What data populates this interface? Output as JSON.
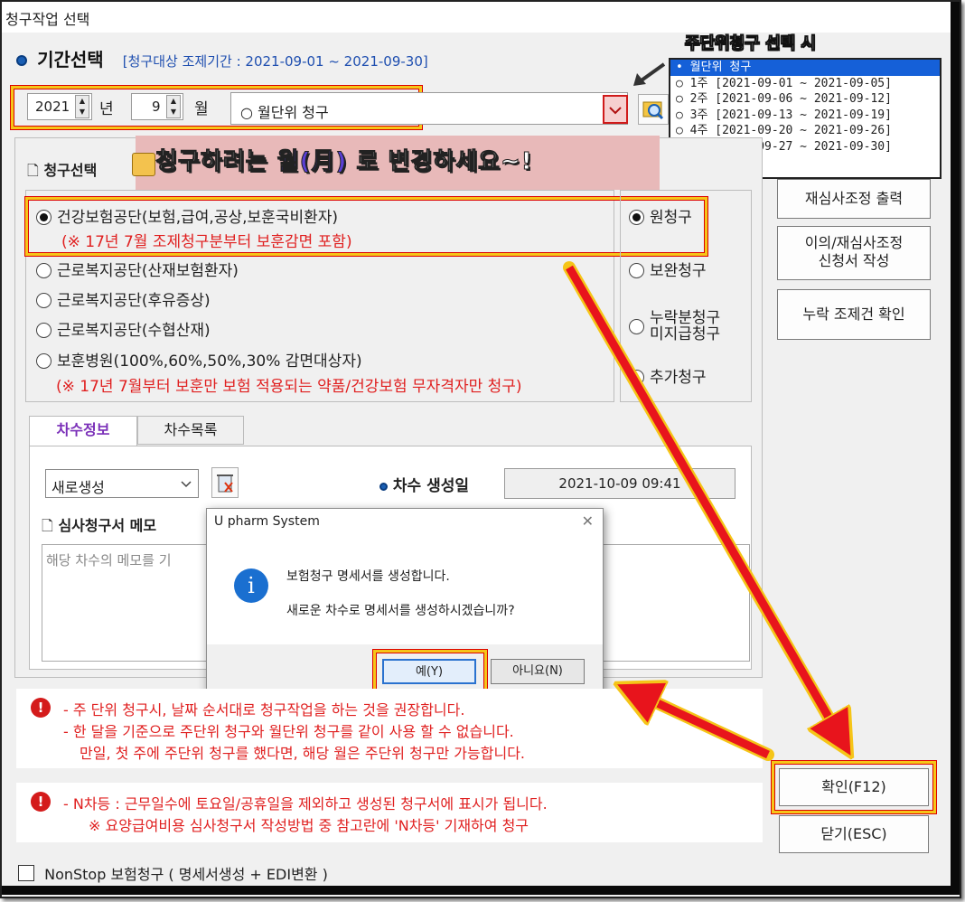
{
  "window": {
    "title": "청구작업 선택"
  },
  "period_section": {
    "title": "기간선택",
    "period_text": "[청구대상 조제기간 : 2021-09-01 ~ 2021-09-30]",
    "year_value": "2021",
    "year_unit": "년",
    "month_value": "9",
    "month_unit": "월",
    "claim_type_value": "○ 월단위 청구"
  },
  "annotations": {
    "weekly_note": "주단위청구 선택 시",
    "banner_prefix": "청구하려는 ",
    "banner_month": "월(月)",
    "banner_suffix": " 로 변경하세요~!"
  },
  "dropdown_list": {
    "items": [
      {
        "label": "• 월단위 청구"
      },
      {
        "label": "○ 1주 [2021-09-01  ~  2021-09-05]"
      },
      {
        "label": "○ 2주 [2021-09-06  ~  2021-09-12]"
      },
      {
        "label": "○ 3주 [2021-09-13  ~  2021-09-19]"
      },
      {
        "label": "○ 4주 [2021-09-20  ~  2021-09-26]"
      },
      {
        "label": "○ 5주 [2021-09-27  ~  2021-09-30]"
      }
    ]
  },
  "claim_section": {
    "title": "청구선택",
    "agencies": [
      {
        "label": "건강보험공단(보험,급여,공상,보훈국비환자)",
        "checked": true
      },
      {
        "label": "근로복지공단(산재보험환자)",
        "checked": false
      },
      {
        "label": "근로복지공단(후유증상)",
        "checked": false
      },
      {
        "label": "근로복지공단(수협산재)",
        "checked": false
      },
      {
        "label": "보훈병원(100%,60%,50%,30% 감면대상자)",
        "checked": false
      }
    ],
    "agency_note_1": "(※ 17년 7월 조제청구분부터 보훈감면 포함)",
    "agency_note_2": "(※ 17년 7월부터 보훈만 보험 적용되는 약품/건강보험 무자격자만 청구)",
    "types": [
      {
        "label": "원청구",
        "checked": true
      },
      {
        "label": "보완청구",
        "checked": false
      },
      {
        "label": "누락분청구\n미지급청구",
        "checked": false
      },
      {
        "label": "추가청구",
        "checked": false
      }
    ]
  },
  "side_buttons": {
    "reexam_print": "재심사조정 출력",
    "objection_line1": "이의/재심사조정",
    "objection_line2": "신청서 작성",
    "missing_check": "누락 조제건 확인",
    "confirm": "확인(F12)",
    "close": "닫기(ESC)"
  },
  "tabs": {
    "active": "차수정보",
    "other": "차수목록"
  },
  "round_info": {
    "select_value": "새로생성",
    "created_label": "차수 생성일",
    "created_value": "2021-10-09 09:41",
    "memo_title": "심사청구서 메모",
    "memo_placeholder": "해당 차수의 메모를 기"
  },
  "dialog": {
    "title": "U pharm System",
    "line1": "보험청구 명세서를 생성합니다.",
    "line2": "새로운 차수로 명세서를 생성하시겠습니까?",
    "yes": "예(Y)",
    "no": "아니요(N)"
  },
  "notes": {
    "weekly_1": "- 주 단위 청구시, 날짜 순서대로 청구작업을 하는 것을 권장합니다.",
    "weekly_2": "- 한 달을 기준으로 주단위 청구와 월단위 청구를 같이 사용 할 수 없습니다.",
    "weekly_3": "만일, 첫 주에 주단위 청구를 했다면, 해당 월은 주단위 청구만 가능합니다.",
    "nday_1": "- N차등 : 근무일수에 토요일/공휴일을 제외하고 생성된 청구서에 표시가 됩니다.",
    "nday_2": "※ 요양급여비용 심사청구서 작성방법 중 참고란에 'N차등' 기재하여 청구"
  },
  "nonstop": {
    "label": "NonStop 보험청구 ( 명세서생성 + EDI변환 )",
    "checked": false
  },
  "colors": {
    "accent_red": "#e02020",
    "highlight_yellow": "#f5c518",
    "arrow_red": "#e8141c",
    "selection_blue": "#1560d8"
  }
}
